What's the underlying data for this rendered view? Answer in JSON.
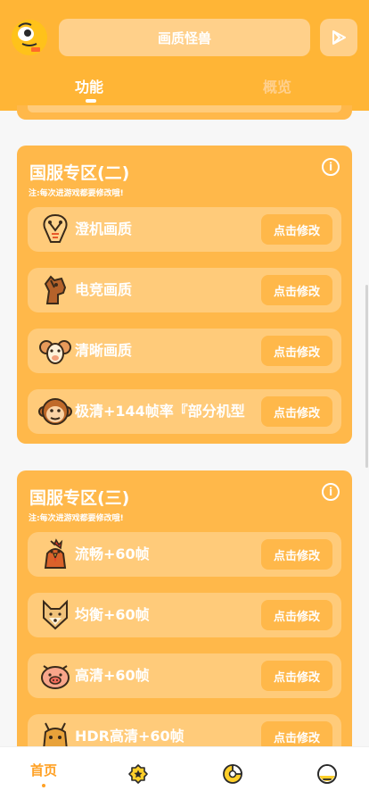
{
  "app": {
    "title": "画质怪兽",
    "tabs": [
      {
        "label": "功能",
        "active": true
      },
      {
        "label": "概览",
        "active": false
      }
    ],
    "accent_color": "#ffb536"
  },
  "sections": [
    {
      "title": "国服专区(二)",
      "note": "注:每次进游戏都要修改哦!",
      "items": [
        {
          "label": "澄机画质",
          "button": "点击修改",
          "icon": "cobra-icon"
        },
        {
          "label": "电竞画质",
          "button": "点击修改",
          "icon": "horse-icon"
        },
        {
          "label": "清晰画质",
          "button": "点击修改",
          "icon": "ram-icon"
        },
        {
          "label": "极清+144帧率『部分机型",
          "button": "点击修改",
          "icon": "monkey-icon"
        }
      ]
    },
    {
      "title": "国服专区(三)",
      "note": "注:每次进游戏都要修改哦!",
      "items": [
        {
          "label": "流畅+60帧",
          "button": "点击修改",
          "icon": "rooster-icon"
        },
        {
          "label": "均衡+60帧",
          "button": "点击修改",
          "icon": "dog-icon"
        },
        {
          "label": "高清+60帧",
          "button": "点击修改",
          "icon": "pig-icon"
        },
        {
          "label": "HDR高清+60帧",
          "button": "点击修改",
          "icon": "dragon-icon"
        }
      ]
    }
  ],
  "bottom_nav": [
    {
      "label": "首页",
      "icon": "home",
      "active": true
    },
    {
      "label": "",
      "icon": "star-badge-icon",
      "active": false
    },
    {
      "label": "",
      "icon": "pie-chart-icon",
      "active": false
    },
    {
      "label": "",
      "icon": "profile-icon",
      "active": false
    }
  ]
}
